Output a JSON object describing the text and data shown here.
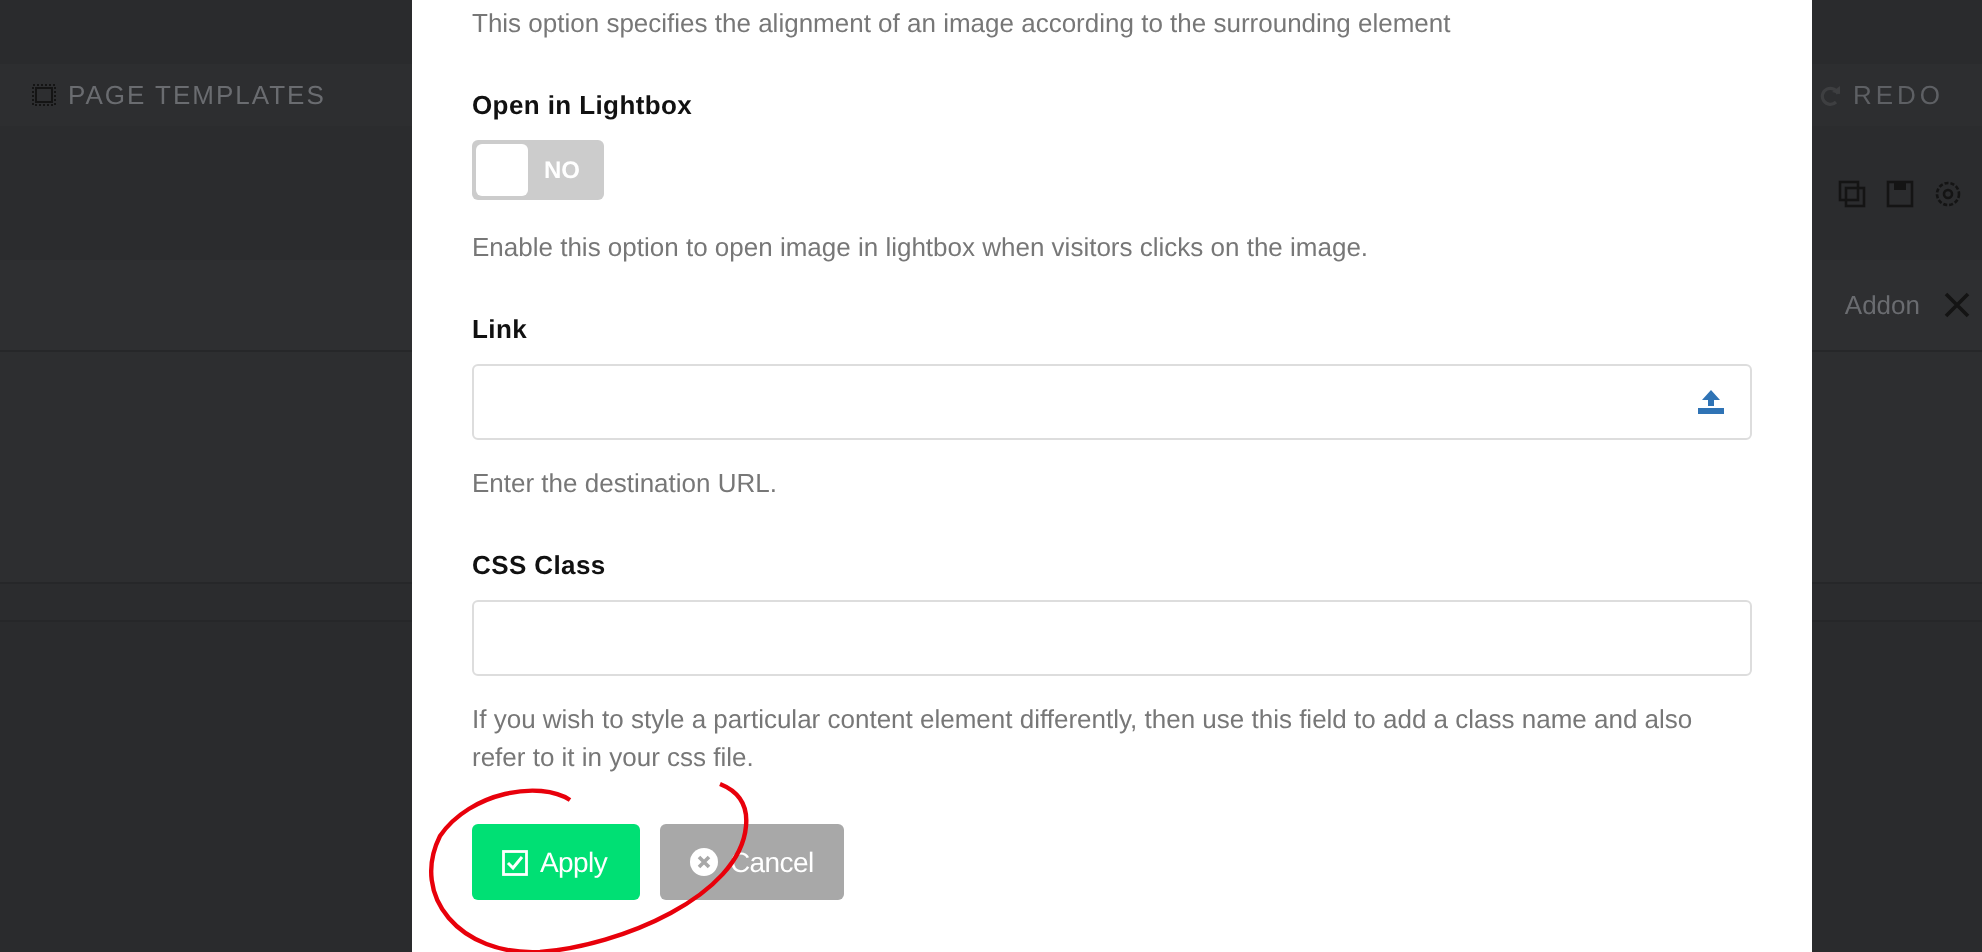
{
  "background": {
    "page_title": "PAGE TEMPLATES",
    "redo": "REDO",
    "addon": "Addon"
  },
  "modal": {
    "top_help": "This option specifies the alignment of an image according to the surrounding element",
    "fields": [
      {
        "kind": "toggle",
        "label": "Open in Lightbox",
        "toggle": {
          "text": "NO",
          "on": false
        },
        "help": "Enable this option to open image in lightbox when visitors clicks on the image."
      },
      {
        "kind": "upload",
        "label": "Link",
        "help": "Enter the destination URL."
      },
      {
        "kind": "text",
        "label": "CSS Class",
        "help": "If you wish to style a particular content element differently, then use this field to add a class name and also refer to it in your css file."
      }
    ],
    "buttons": [
      {
        "kind": "apply",
        "label": "Apply"
      },
      {
        "kind": "cancel",
        "label": "Cancel"
      }
    ]
  }
}
